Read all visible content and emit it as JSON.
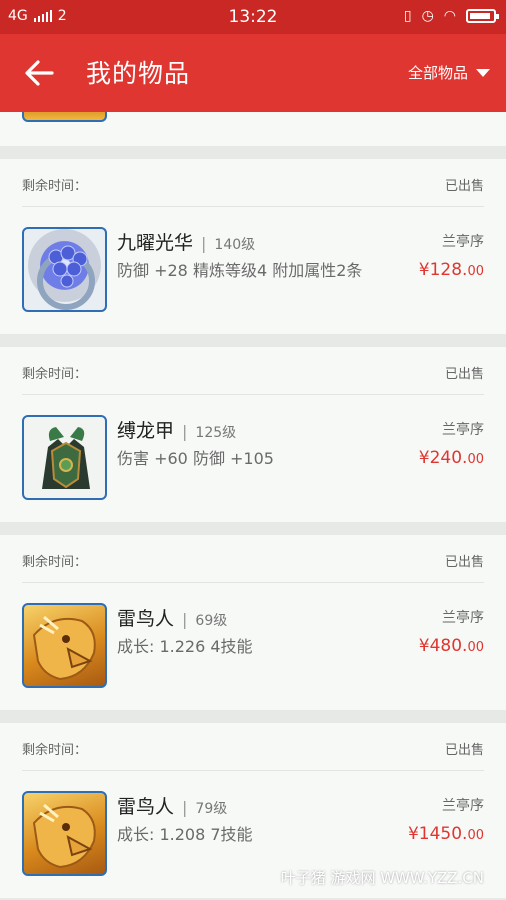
{
  "status_bar": {
    "network": "4G",
    "sim": "2",
    "time": "13:22"
  },
  "header": {
    "title": "我的物品",
    "filter_label": "全部物品"
  },
  "listings": [
    {
      "remaining_label": "剩余时间：",
      "status": "已出售",
      "name": "九曜光华",
      "level": "140级",
      "stats": "防御 +28  精炼等级4  附加属性2条",
      "seller": "兰亭序",
      "price_main": "¥128.",
      "price_dec": "00",
      "icon": "gem-ring-icon"
    },
    {
      "remaining_label": "剩余时间：",
      "status": "已出售",
      "name": "缚龙甲",
      "level": "125级",
      "stats": "伤害 +60 防御 +105",
      "seller": "兰亭序",
      "price_main": "¥240.",
      "price_dec": "00",
      "icon": "armor-icon"
    },
    {
      "remaining_label": "剩余时间：",
      "status": "已出售",
      "name": "雷鸟人",
      "level": "69级",
      "stats": "成长: 1.226  4技能",
      "seller": "兰亭序",
      "price_main": "¥480.",
      "price_dec": "00",
      "icon": "thunderbird-icon"
    },
    {
      "remaining_label": "剩余时间：",
      "status": "已出售",
      "name": "雷鸟人",
      "level": "79级",
      "stats": "成长: 1.208  7技能",
      "seller": "兰亭序",
      "price_main": "¥1450.",
      "price_dec": "00",
      "icon": "thunderbird-icon"
    }
  ],
  "watermark": "叶子猪 游戏网 WWW.YZZ.CN",
  "colors": {
    "header": "#e03631",
    "status_bar": "#c92824",
    "price": "#e03631"
  }
}
